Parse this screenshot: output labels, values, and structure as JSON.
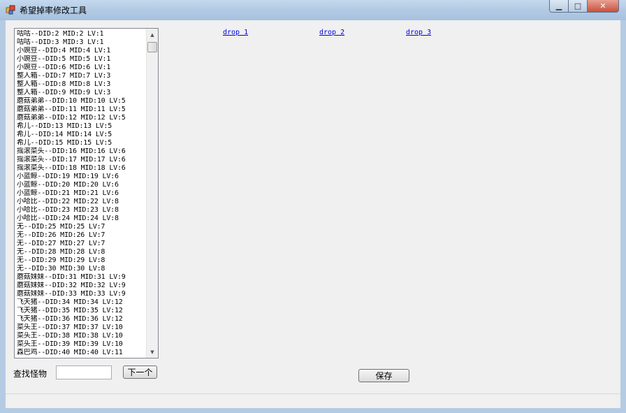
{
  "window": {
    "title": "希望掉率修改工具",
    "minimize_glyph": "▁",
    "maximize_glyph": "□",
    "close_glyph": "✕"
  },
  "monster_list": {
    "items": [
      "咕咕--DID:2 MID:2 LV:1",
      "咕咕--DID:3 MID:3 LV:1",
      "小豌豆--DID:4 MID:4 LV:1",
      "小豌豆--DID:5 MID:5 LV:1",
      "小豌豆--DID:6 MID:6 LV:1",
      "整人箱--DID:7 MID:7 LV:3",
      "整人箱--DID:8 MID:8 LV:3",
      "整人箱--DID:9 MID:9 LV:3",
      "蘑菇弟弟--DID:10 MID:10 LV:5",
      "蘑菇弟弟--DID:11 MID:11 LV:5",
      "蘑菇弟弟--DID:12 MID:12 LV:5",
      "希儿--DID:13 MID:13 LV:5",
      "希儿--DID:14 MID:14 LV:5",
      "希儿--DID:15 MID:15 LV:5",
      "摇滚菜头--DID:16 MID:16 LV:6",
      "摇滚菜头--DID:17 MID:17 LV:6",
      "摇滚菜头--DID:18 MID:18 LV:6",
      "小蓝鲸--DID:19 MID:19 LV:6",
      "小蓝鲸--DID:20 MID:20 LV:6",
      "小蓝鲸--DID:21 MID:21 LV:6",
      "小哈比--DID:22 MID:22 LV:8",
      "小哈比--DID:23 MID:23 LV:8",
      "小哈比--DID:24 MID:24 LV:8",
      "无--DID:25 MID:25 LV:7",
      "无--DID:26 MID:26 LV:7",
      "无--DID:27 MID:27 LV:7",
      "无--DID:28 MID:28 LV:8",
      "无--DID:29 MID:29 LV:8",
      "无--DID:30 MID:30 LV:8",
      "蘑菇妹妹--DID:31 MID:31 LV:9",
      "蘑菇妹妹--DID:32 MID:32 LV:9",
      "蘑菇妹妹--DID:33 MID:33 LV:9",
      "飞天猪--DID:34 MID:34 LV:12",
      "飞天猪--DID:35 MID:35 LV:12",
      "飞天猪--DID:36 MID:36 LV:12",
      "菜头王--DID:37 MID:37 LV:10",
      "菜头王--DID:38 MID:38 LV:10",
      "菜头王--DID:39 MID:39 LV:10",
      "森巴鸡--DID:40 MID:40 LV:11"
    ],
    "scroll_up_glyph": "▲",
    "scroll_down_glyph": "▼"
  },
  "links": {
    "drop1": "drop 1",
    "drop2": "drop 2",
    "drop3": "drop 3"
  },
  "search": {
    "label": "查找怪物",
    "value": "",
    "next_button": "下一个"
  },
  "save_button": "保存"
}
